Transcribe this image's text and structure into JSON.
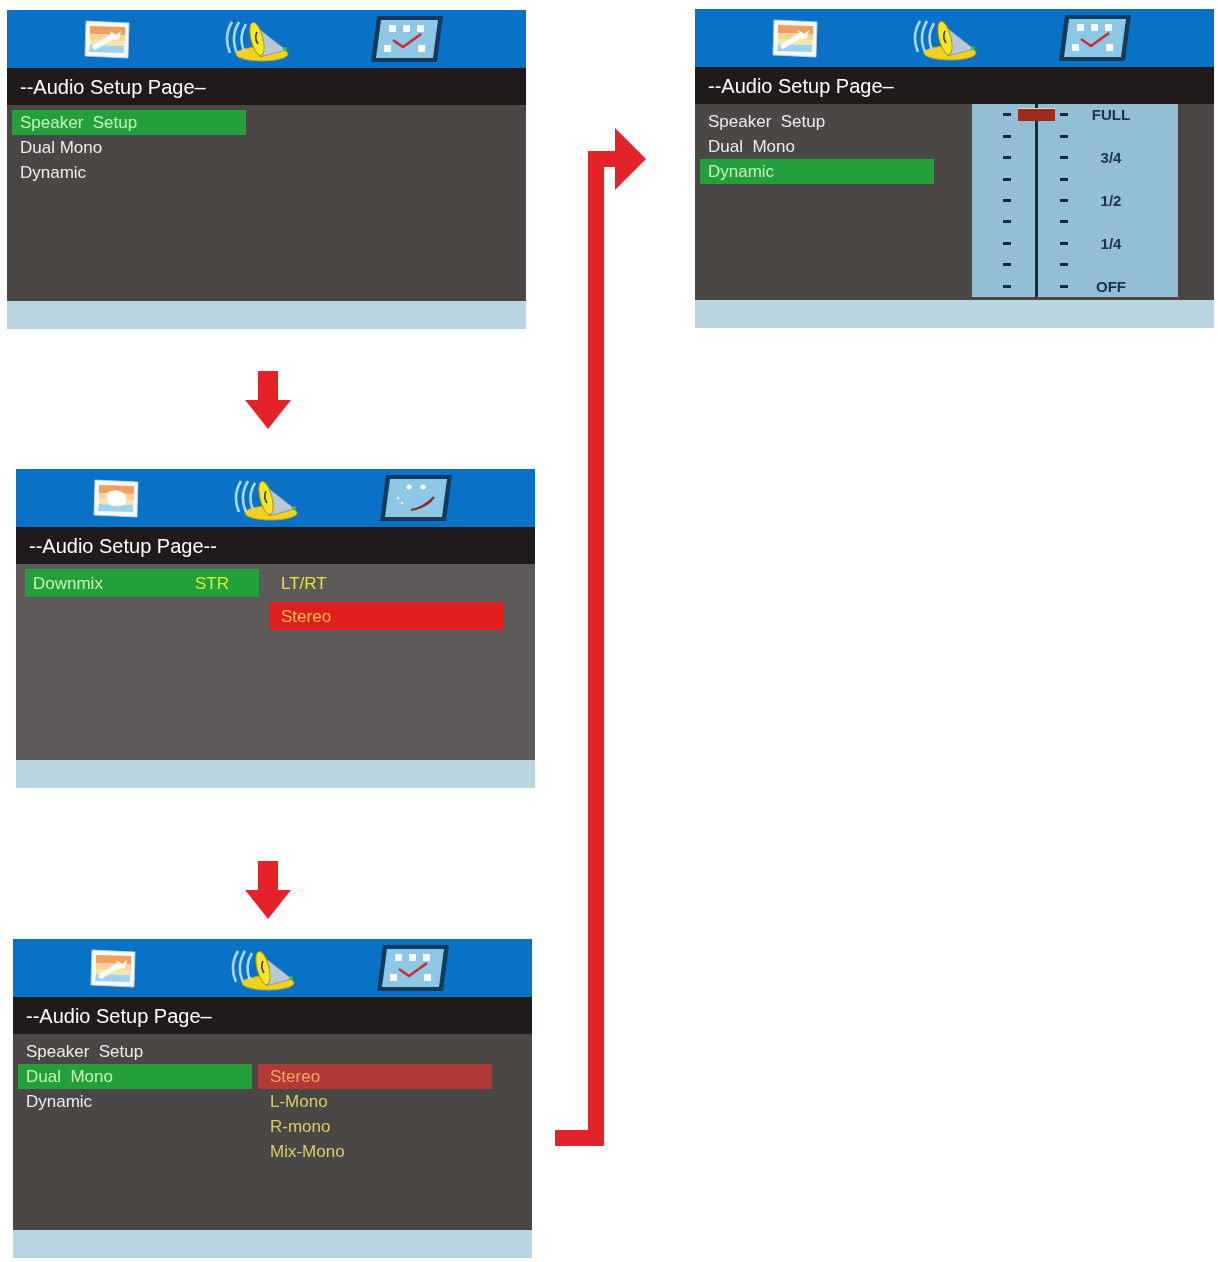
{
  "screens": [
    {
      "kind": "list",
      "icons": [
        {
          "kind": "wrench-picture"
        },
        {
          "kind": "speaker"
        },
        {
          "kind": "check-screen"
        }
      ],
      "title": "--Audio Setup Page–",
      "items": [
        {
          "label": "Speaker  Setup",
          "selected": true
        },
        {
          "label": "Dual Mono",
          "selected": false
        },
        {
          "label": "Dynamic",
          "selected": false
        }
      ]
    },
    {
      "kind": "value",
      "icons": [
        {
          "kind": "blob-picture"
        },
        {
          "kind": "speaker"
        },
        {
          "kind": "face-screen"
        }
      ],
      "title": "--Audio Setup Page--",
      "items": [
        {
          "label": "Downmix",
          "value": "STR",
          "selected": true
        }
      ],
      "options": [
        {
          "label": "LT/RT",
          "selected": false
        },
        {
          "label": "Stereo",
          "selected": true
        }
      ]
    },
    {
      "kind": "list",
      "icons": [
        {
          "kind": "wrench-picture"
        },
        {
          "kind": "speaker"
        },
        {
          "kind": "check-screen"
        }
      ],
      "title": "--Audio Setup Page–",
      "items": [
        {
          "label": "Speaker  Setup",
          "selected": false
        },
        {
          "label": "Dual  Mono",
          "selected": true
        },
        {
          "label": "Dynamic",
          "selected": false
        }
      ],
      "options": [
        {
          "label": "Stereo",
          "selected": true
        },
        {
          "label": "L-Mono",
          "selected": false
        },
        {
          "label": "R-mono",
          "selected": false
        },
        {
          "label": "Mix-Mono",
          "selected": false
        }
      ]
    },
    {
      "kind": "slider",
      "icons": [
        {
          "kind": "wrench-picture"
        },
        {
          "kind": "speaker"
        },
        {
          "kind": "check-screen"
        }
      ],
      "title": "--Audio Setup Page–",
      "items": [
        {
          "label": "Speaker  Setup",
          "selected": false
        },
        {
          "label": "Dual  Mono",
          "selected": false
        },
        {
          "label": "Dynamic",
          "selected": true
        }
      ],
      "slider": {
        "level": 1,
        "labels": [
          "FULL",
          "3/4",
          "1/2",
          "1/4",
          "OFF"
        ]
      }
    }
  ]
}
